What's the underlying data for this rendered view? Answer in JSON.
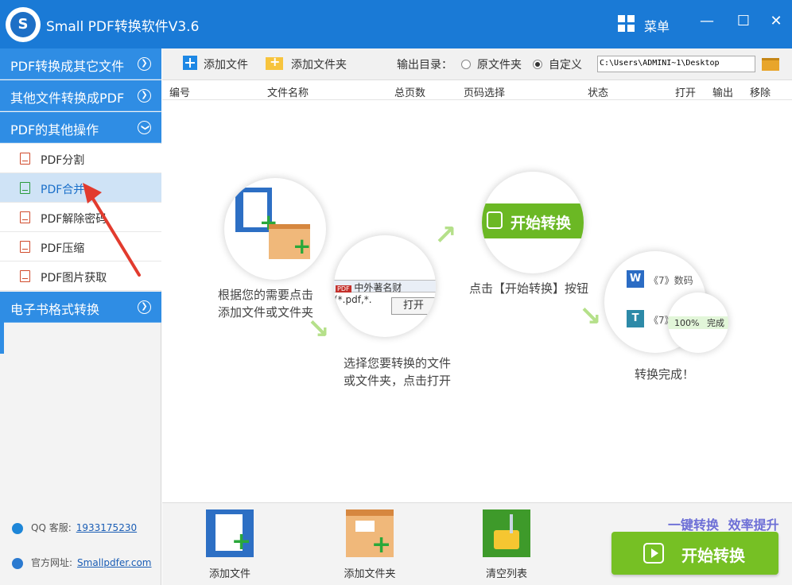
{
  "app": {
    "logo_letter": "S",
    "title": "Small PDF转换软件V3.6",
    "menu_label": "菜单",
    "minimize_glyph": "—",
    "maximize_glyph": "☐",
    "close_glyph": "✕"
  },
  "sidebar": {
    "groups": [
      {
        "label": "PDF转换成其它文件",
        "expanded": false
      },
      {
        "label": "其他文件转换成PDF",
        "expanded": false
      },
      {
        "label": "PDF的其他操作",
        "expanded": true
      },
      {
        "label": "电子书格式转换",
        "expanded": false
      }
    ],
    "items": [
      {
        "label": "PDF分割",
        "icon": "pdf-file-icon"
      },
      {
        "label": "PDF合并",
        "icon": "pdf-file-icon",
        "selected": true
      },
      {
        "label": "PDF解除密码",
        "icon": "pdf-file-icon"
      },
      {
        "label": "PDF压缩",
        "icon": "pdf-file-icon"
      },
      {
        "label": "PDF图片获取",
        "icon": "pdf-file-icon"
      }
    ],
    "qq_label": "QQ 客服:",
    "qq_value": "1933175230",
    "site_label": "官方网址:",
    "site_value": "Smallpdfer.com"
  },
  "toolbar": {
    "add_file": "添加文件",
    "add_folder": "添加文件夹",
    "output_label": "输出目录：",
    "option_original": "原文件夹",
    "option_custom": "自定义",
    "selected_option": "自定义",
    "output_path": "C:\\Users\\ADMINI~1\\Desktop"
  },
  "table": {
    "columns": [
      "编号",
      "文件名称",
      "总页数",
      "页码选择",
      "状态",
      "打开",
      "输出",
      "移除"
    ]
  },
  "guide": {
    "step1": [
      "根据您的需要点击",
      "添加文件或文件夹"
    ],
    "step2": [
      "选择您要转换的文件",
      "或文件夹，点击打开"
    ],
    "step3": "点击【开始转换】按钮",
    "step4": "转换完成！",
    "mock_file_text": "中外著名财",
    "mock_ext_text": "(*.pdf,*.",
    "mock_open_btn": "打开",
    "mock_start_btn": "开始转换",
    "mock_list_1": "《7》数码",
    "mock_list_2": "《7》",
    "mock_progress": "100%",
    "mock_done": "完成",
    "mock_word_letter": "W",
    "mock_t_letter": "T",
    "mock_pdf_tag": "PDF"
  },
  "bottom": {
    "add_file": "添加文件",
    "add_folder": "添加文件夹",
    "clear_list": "清空列表",
    "slogan_1": "一键转换",
    "slogan_2": "效率提升",
    "start_button": "开始转换"
  },
  "colors": {
    "title_blue": "#1a7ad6",
    "sidebar_blue": "#2f8de4",
    "start_green": "#76c024",
    "slogan_purple": "#6d6fd6"
  }
}
